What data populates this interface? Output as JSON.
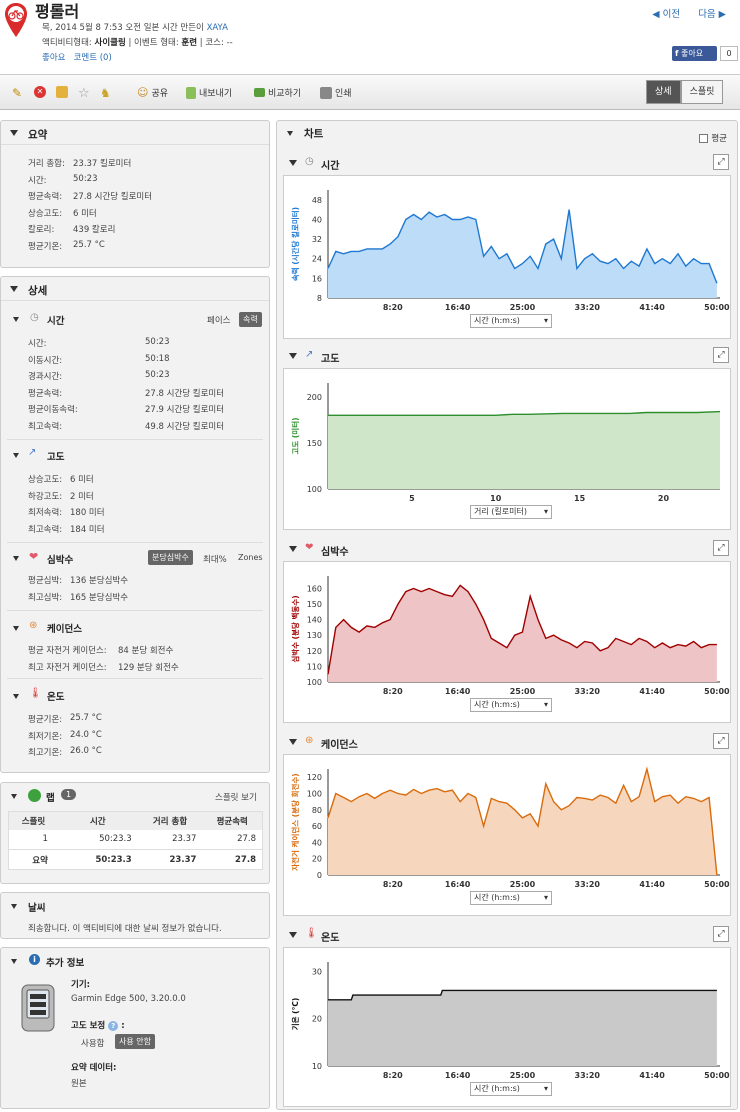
{
  "header": {
    "title": "평롤러",
    "meta1": "목, 2014 5월 8 7:53 오전 일본 시간 만든이",
    "author": "XAYA",
    "activity_type_label": "액티비티형태:",
    "activity_type": "사이클링",
    "event_type_label": "| 이벤트 형태:",
    "event_type": "훈련",
    "course": "| 코스: --",
    "like_link": "좋아요",
    "comment_link": "코멘트 (0)",
    "prev": "◀ 이전",
    "next": "다음 ▶",
    "fb_like": "좋아요",
    "fb_count": "0"
  },
  "toolbar": {
    "share": "공유",
    "export": "내보내기",
    "compare": "비교하기",
    "print": "인쇄",
    "detail": "상세",
    "split": "스플릿"
  },
  "summary": {
    "title": "요약",
    "rows": [
      [
        "거리 총합:",
        "23.37 킬로미터"
      ],
      [
        "시간:",
        "50:23"
      ],
      [
        "평균속력:",
        "27.8 시간당 킬로미터"
      ],
      [
        "상승고도:",
        "6 미터"
      ],
      [
        "칼로리:",
        "439 칼로리"
      ],
      [
        "평균기온:",
        "25.7 °C"
      ]
    ]
  },
  "detail": {
    "title": "상세",
    "time": {
      "title": "시간",
      "pace": "페이스",
      "speed": "속력",
      "rows": [
        [
          "시간:",
          "50:23"
        ],
        [
          "이동시간:",
          "50:18"
        ],
        [
          "경과시간:",
          "50:23"
        ],
        [
          "평균속력:",
          "27.8 시간당 킬로미터"
        ],
        [
          "평균이동속력:",
          "27.9 시간당 킬로미터"
        ],
        [
          "최고속력:",
          "49.8 시간당 킬로미터"
        ]
      ]
    },
    "elev": {
      "title": "고도",
      "rows": [
        [
          "상승고도:",
          "6 미터"
        ],
        [
          "하강고도:",
          "2 미터"
        ],
        [
          "최저속력:",
          "180 미터"
        ],
        [
          "최고속력:",
          "184 미터"
        ]
      ]
    },
    "hr": {
      "title": "심박수",
      "opt1": "분당심박수",
      "opt2": "최대%",
      "opt3": "Zones",
      "rows": [
        [
          "평균심박:",
          "136 분당심박수"
        ],
        [
          "최고심박:",
          "165 분당심박수"
        ]
      ]
    },
    "cad": {
      "title": "케이던스",
      "rows": [
        [
          "평균 자전거 케이던스:",
          "84 분당 회전수"
        ],
        [
          "최고 자전거 케이던스:",
          "129 분당 회전수"
        ]
      ]
    },
    "temp": {
      "title": "온도",
      "rows": [
        [
          "평균기온:",
          "25.7 °C"
        ],
        [
          "최저기온:",
          "24.0 °C"
        ],
        [
          "최고기온:",
          "26.0 °C"
        ]
      ]
    }
  },
  "laps": {
    "title": "랩",
    "count": "1",
    "split_view": "스플릿 보기",
    "cols": [
      "스플릿",
      "시간",
      "거리 총합",
      "평균속력"
    ],
    "row": [
      "1",
      "50:23.3",
      "23.37",
      "27.8"
    ],
    "total": [
      "요약",
      "50:23.3",
      "23.37",
      "27.8"
    ]
  },
  "weather": {
    "title": "날씨",
    "text": "죄송합니다. 이 액티비티에 대한 날씨 정보가 없습니다."
  },
  "extra": {
    "title": "추가 정보",
    "device_label": "기기:",
    "device": "Garmin Edge 500, 3.20.0.0",
    "elev_corr_label": "고도 보정",
    "elev_corr_colon": ":",
    "opt_use": "사용함",
    "opt_nouse": "사용 안함",
    "summary_data_label": "요약 데이터:",
    "summary_data": "원본"
  },
  "charts": {
    "title": "차트",
    "avg_label": "평균",
    "speed": {
      "title": "시간",
      "ylabel": "속력 (시간당 킬로미터)",
      "xsel": "시간 (h:m:s)",
      "color": "#1f78d1"
    },
    "elev": {
      "title": "고도",
      "ylabel": "고도 (미터)",
      "xsel": "거리 (킬로미터)",
      "color": "#2f8f2f"
    },
    "hr": {
      "title": "심박수",
      "ylabel": "심박수 (분당 백동수)",
      "xsel": "시간 (h:m:s)",
      "color": "#a00000"
    },
    "cad": {
      "title": "케이던스",
      "ylabel": "자전거 케이던스 (분당 회전수)",
      "xsel": "시간 (h:m:s)",
      "color": "#d96b0c"
    },
    "temp": {
      "title": "온도",
      "ylabel": "기온 (°C)",
      "xsel": "시간 (h:m:s)",
      "color": "#111111"
    }
  },
  "chart_data": [
    {
      "type": "area",
      "title": "시간",
      "ylabel": "속력 (시간당 킬로미터)",
      "xlabel": "시간 (h:m:s)",
      "x_ticks": [
        "8:20",
        "16:40",
        "25:00",
        "33:20",
        "41:40",
        "50:00"
      ],
      "y_ticks": [
        8,
        16,
        24,
        32,
        40,
        48
      ],
      "ylim": [
        8,
        52
      ],
      "xlim_minutes": [
        0,
        50.4
      ],
      "x": [
        0,
        1,
        2,
        3,
        4,
        5,
        6,
        7,
        8,
        9,
        10,
        11,
        12,
        13,
        14,
        15,
        16,
        17,
        18,
        19,
        20,
        21,
        22,
        23,
        24,
        25,
        26,
        27,
        28,
        29,
        30,
        31,
        32,
        33,
        34,
        35,
        36,
        37,
        38,
        39,
        40,
        41,
        42,
        43,
        44,
        45,
        46,
        47,
        48,
        49,
        50
      ],
      "values": [
        20,
        27,
        26,
        27,
        27,
        28,
        28,
        28,
        30,
        33,
        40,
        42,
        40,
        43,
        41,
        42,
        40,
        40,
        41,
        40,
        25,
        29,
        24,
        26,
        20,
        22,
        25,
        20,
        30,
        32,
        24,
        44,
        20,
        24,
        26,
        23,
        22,
        24,
        20,
        23,
        21,
        28,
        22,
        24,
        22,
        26,
        21,
        24,
        22,
        22,
        14
      ]
    },
    {
      "type": "area",
      "title": "고도",
      "ylabel": "고도 (미터)",
      "xlabel": "거리 (킬로미터)",
      "x_ticks": [
        5,
        10,
        15,
        20
      ],
      "y_ticks": [
        100,
        150,
        200
      ],
      "ylim": [
        100,
        215
      ],
      "xlim": [
        0,
        23.37
      ],
      "x": [
        0,
        2,
        4,
        6,
        8,
        10,
        11,
        12,
        14,
        16,
        18,
        19,
        20,
        22,
        23.37
      ],
      "values": [
        180,
        180,
        180,
        180,
        180,
        180,
        181,
        181,
        182,
        182,
        182,
        183,
        183,
        183,
        184
      ]
    },
    {
      "type": "area",
      "title": "심박수",
      "ylabel": "심박수 (분당 백동수)",
      "xlabel": "시간 (h:m:s)",
      "x_ticks": [
        "8:20",
        "16:40",
        "25:00",
        "33:20",
        "41:40",
        "50:00"
      ],
      "y_ticks": [
        100,
        110,
        120,
        130,
        140,
        150,
        160
      ],
      "ylim": [
        100,
        168
      ],
      "xlim_minutes": [
        0,
        50.4
      ],
      "x": [
        0,
        1,
        2,
        3,
        4,
        5,
        6,
        7,
        8,
        9,
        10,
        11,
        12,
        13,
        14,
        15,
        16,
        17,
        18,
        19,
        20,
        21,
        22,
        23,
        24,
        25,
        26,
        27,
        28,
        29,
        30,
        31,
        32,
        33,
        34,
        35,
        36,
        37,
        38,
        39,
        40,
        41,
        42,
        43,
        44,
        45,
        46,
        47,
        48,
        49,
        50
      ],
      "values": [
        105,
        135,
        140,
        135,
        132,
        136,
        135,
        138,
        140,
        150,
        158,
        160,
        158,
        160,
        158,
        156,
        155,
        162,
        158,
        150,
        140,
        128,
        125,
        122,
        130,
        132,
        155,
        140,
        128,
        130,
        127,
        125,
        122,
        126,
        125,
        120,
        122,
        128,
        126,
        124,
        128,
        126,
        122,
        125,
        122,
        124,
        123,
        126,
        122,
        124,
        124
      ]
    },
    {
      "type": "area",
      "title": "케이던스",
      "ylabel": "자전거 케이던스 (분당 회전수)",
      "xlabel": "시간 (h:m:s)",
      "x_ticks": [
        "8:20",
        "16:40",
        "25:00",
        "33:20",
        "41:40",
        "50:00"
      ],
      "y_ticks": [
        0,
        20,
        40,
        60,
        80,
        100,
        120
      ],
      "ylim": [
        0,
        130
      ],
      "xlim_minutes": [
        0,
        50.4
      ],
      "x": [
        0,
        1,
        2,
        3,
        4,
        5,
        6,
        7,
        8,
        9,
        10,
        11,
        12,
        13,
        14,
        15,
        16,
        17,
        18,
        19,
        20,
        21,
        22,
        23,
        24,
        25,
        26,
        27,
        28,
        29,
        30,
        31,
        32,
        33,
        34,
        35,
        36,
        37,
        38,
        39,
        40,
        41,
        42,
        43,
        44,
        45,
        46,
        47,
        48,
        49,
        50
      ],
      "values": [
        70,
        100,
        95,
        90,
        96,
        100,
        94,
        100,
        104,
        100,
        98,
        105,
        100,
        104,
        106,
        102,
        104,
        90,
        100,
        95,
        60,
        94,
        90,
        88,
        80,
        70,
        75,
        60,
        112,
        90,
        80,
        85,
        95,
        94,
        92,
        98,
        95,
        88,
        110,
        90,
        96,
        130,
        90,
        96,
        98,
        88,
        96,
        94,
        90,
        95,
        0
      ]
    },
    {
      "type": "area",
      "title": "온도",
      "ylabel": "기온 (°C)",
      "xlabel": "시간 (h:m:s)",
      "x_ticks": [
        "8:20",
        "16:40",
        "25:00",
        "33:20",
        "41:40",
        "50:00"
      ],
      "y_ticks": [
        10,
        20,
        30
      ],
      "ylim": [
        10,
        32
      ],
      "xlim_minutes": [
        0,
        50.4
      ],
      "x": [
        0,
        3,
        3.2,
        14.5,
        14.7,
        50
      ],
      "values": [
        24,
        24,
        25,
        25,
        26,
        26
      ]
    }
  ]
}
